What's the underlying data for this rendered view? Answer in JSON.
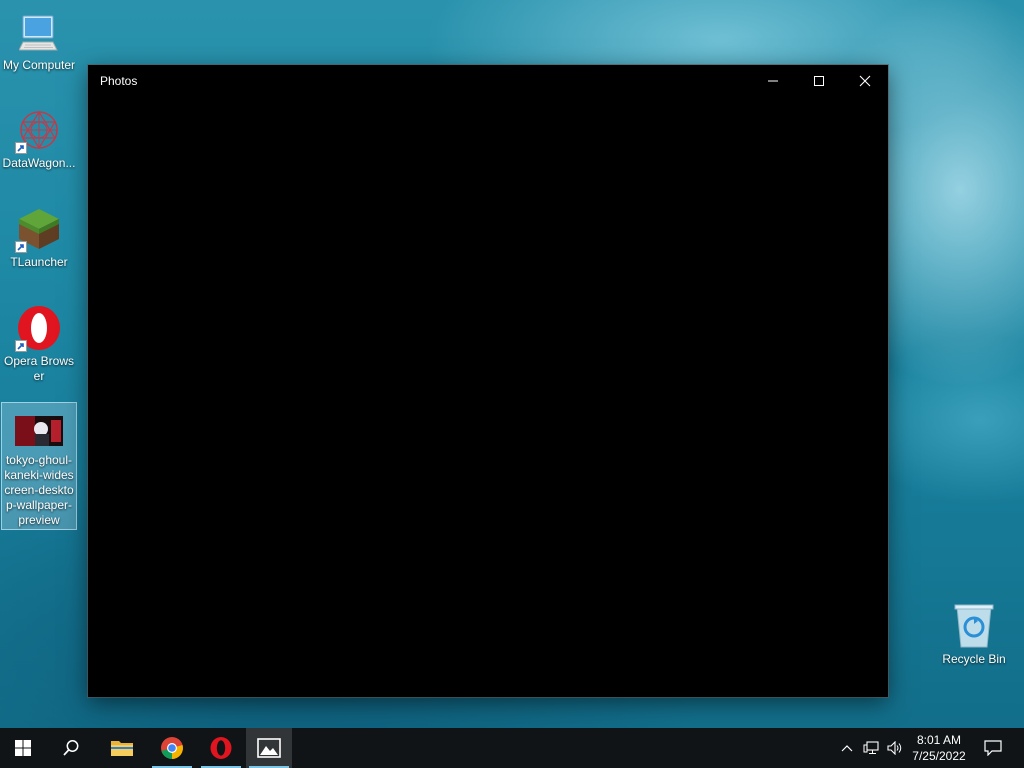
{
  "desktop": {
    "icons": [
      {
        "label": "My Computer",
        "icon": "computer-icon"
      },
      {
        "label": "DataWagon...",
        "icon": "datawagon-icon"
      },
      {
        "label": "TLauncher",
        "icon": "tlauncher-icon"
      },
      {
        "label": "Opera Browser",
        "icon": "opera-icon"
      },
      {
        "label": "tokyo-ghoul-kaneki-widescreen-desktop-wallpaper-preview",
        "icon": "image-file-icon"
      }
    ],
    "recycle_bin": {
      "label": "Recycle Bin",
      "icon": "recycle-bin-icon"
    }
  },
  "window": {
    "title": "Photos",
    "buttons": [
      "minimize",
      "maximize",
      "close"
    ]
  },
  "taskbar": {
    "items": [
      "start",
      "search",
      "file-explorer",
      "chrome",
      "opera",
      "photos"
    ],
    "tray": {
      "time": "8:01 AM",
      "date": "7/25/2022"
    }
  },
  "colors": {
    "taskbar_bg": "#101417",
    "running_indicator": "#7cc5e6",
    "window_bg": "#000000"
  }
}
